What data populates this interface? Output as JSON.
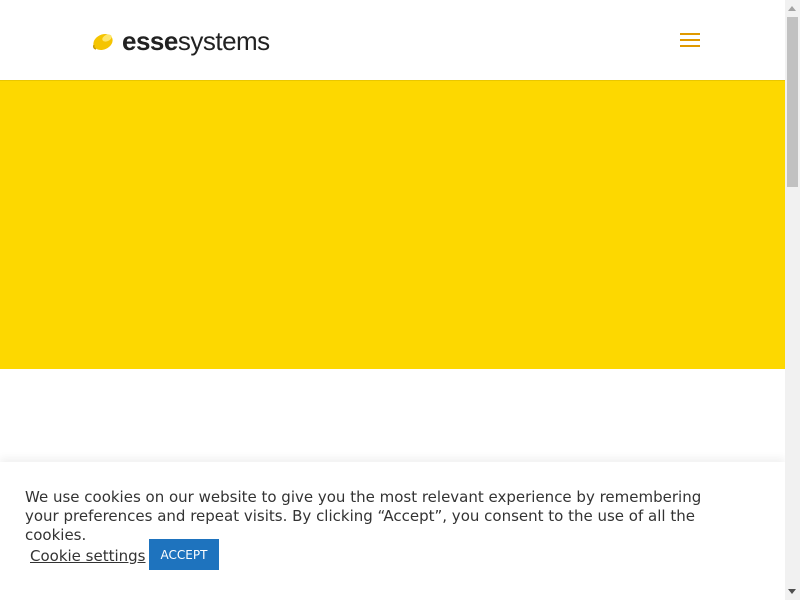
{
  "colors": {
    "hero_background": "#fdd800",
    "menu_icon": "#e09900",
    "accept_button": "#1e73be",
    "logo_mark": "#f5c400"
  },
  "header": {
    "logo": {
      "text_bold": "esse",
      "text_light": "systems",
      "icon": "lemon-logo-icon"
    },
    "menu_icon": "hamburger-menu-icon"
  },
  "cookie_banner": {
    "message": "We use cookies on our website to give you the most relevant experience by remembering your preferences and repeat visits. By clicking “Accept”, you consent to the use of all the cookies.",
    "settings_label": "Cookie settings",
    "accept_label": "ACCEPT"
  }
}
